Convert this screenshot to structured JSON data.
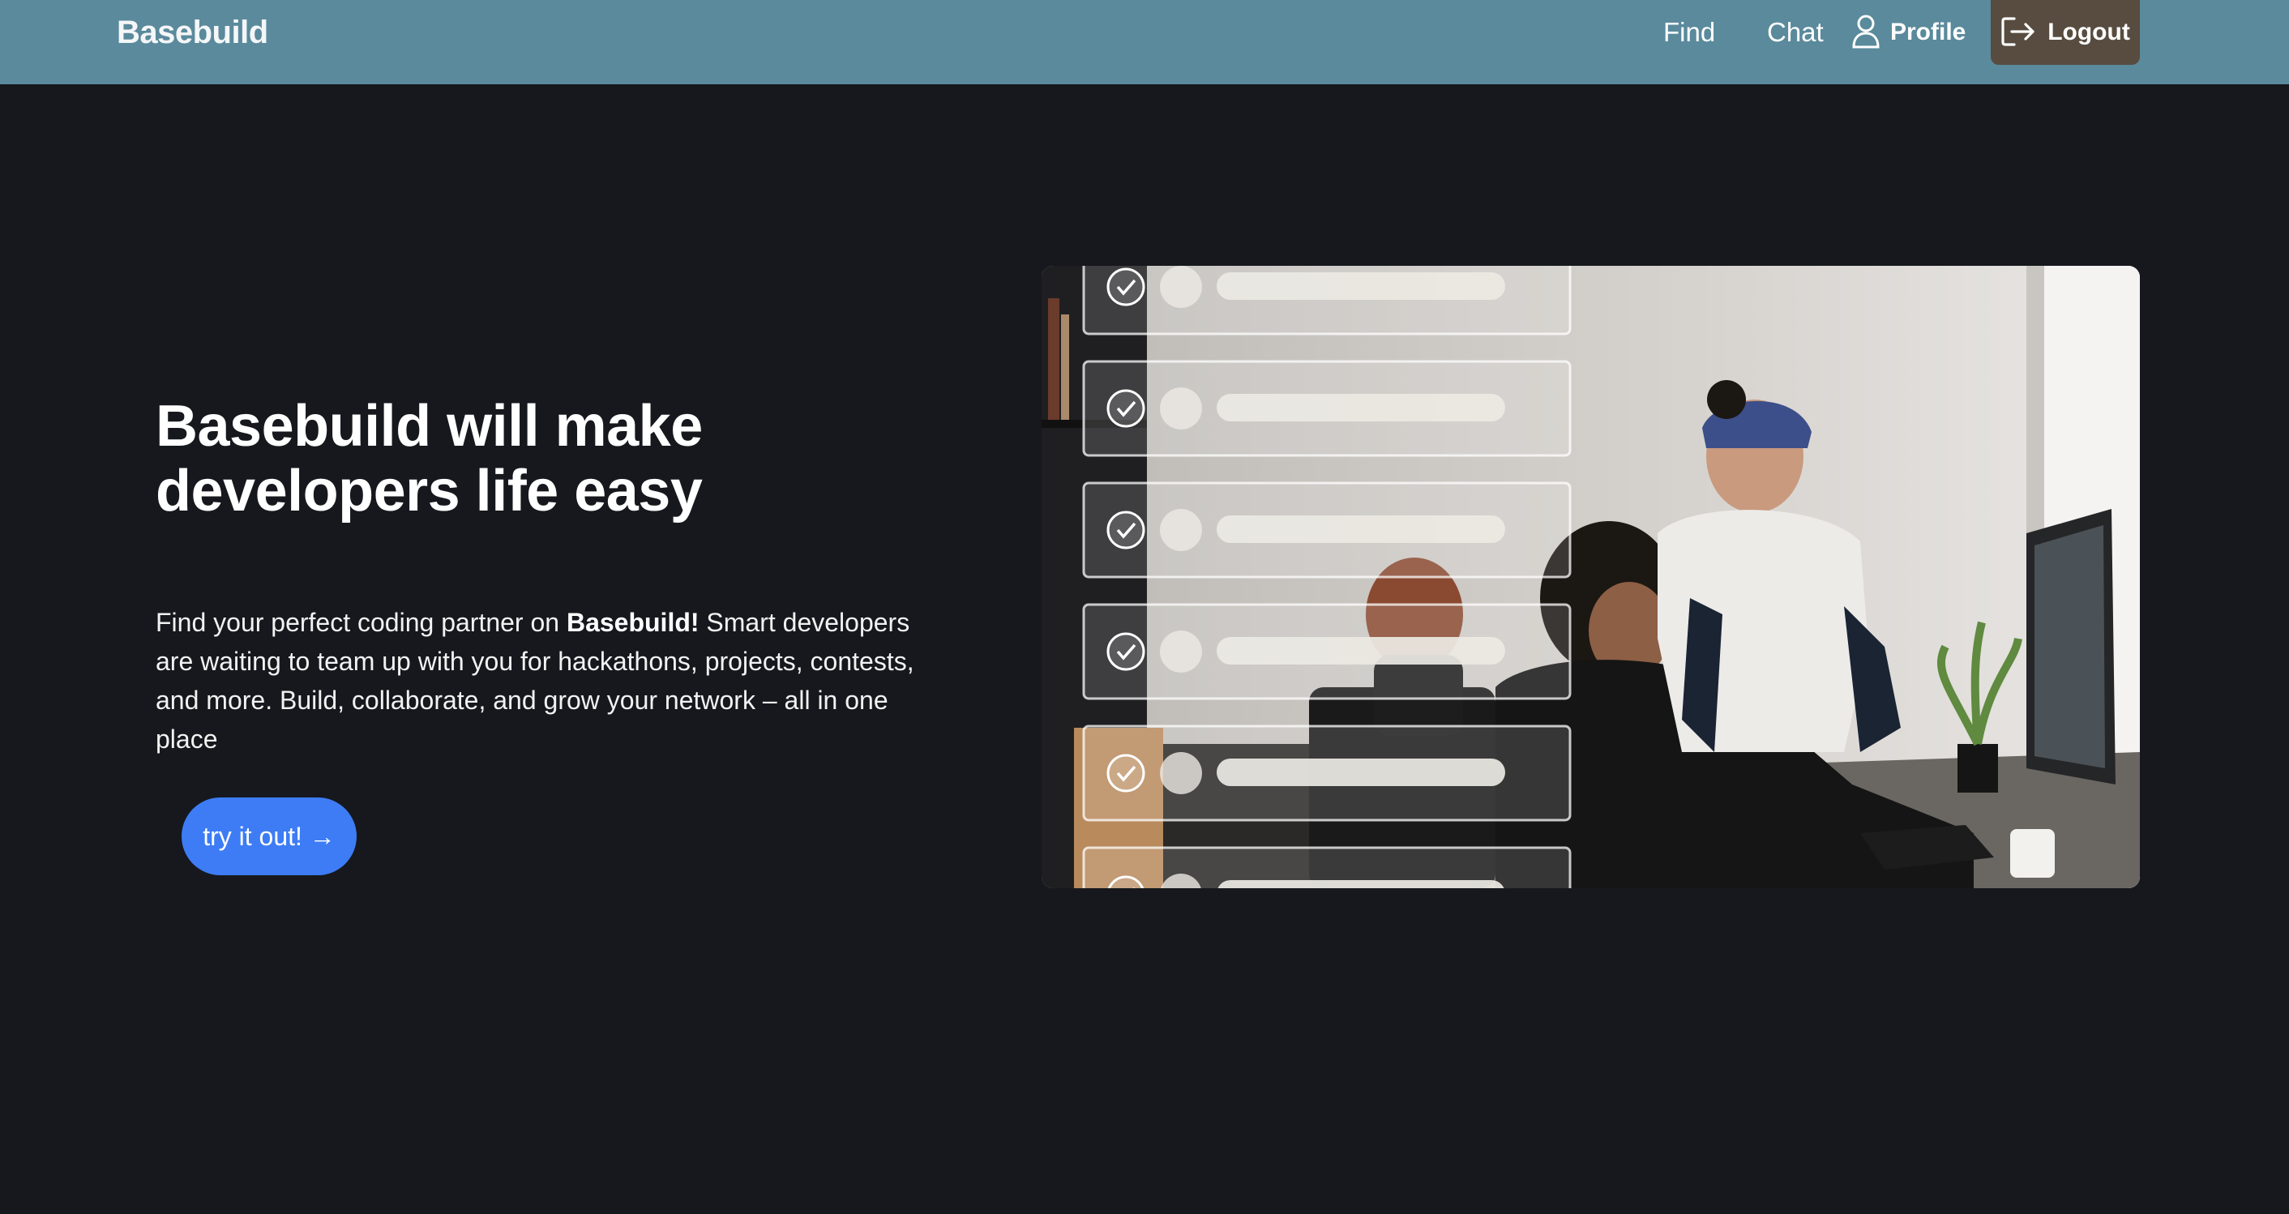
{
  "navbar": {
    "brand": "Basebuild",
    "links": {
      "find": "Find",
      "chat": "Chat",
      "profile": "Profile"
    },
    "logout": "Logout",
    "icons": {
      "profile": "user-icon",
      "logout": "logout-icon"
    },
    "colors": {
      "bar": "#5a8a9c",
      "logout_bg": "#574c3f"
    }
  },
  "hero": {
    "headline": "Basebuild will make developers life easy",
    "description": {
      "before": "Find your perfect coding partner on ",
      "brand": "Basebuild!",
      "after": " Smart developers are waiting to team up with you for hackathons, projects, contests, and more. Build, collaborate, and grow your network – all in one place"
    },
    "cta": "try it out! →",
    "cta_color": "#3d7cf5",
    "checklist_items": 6
  },
  "page": {
    "background": "#16181d"
  }
}
